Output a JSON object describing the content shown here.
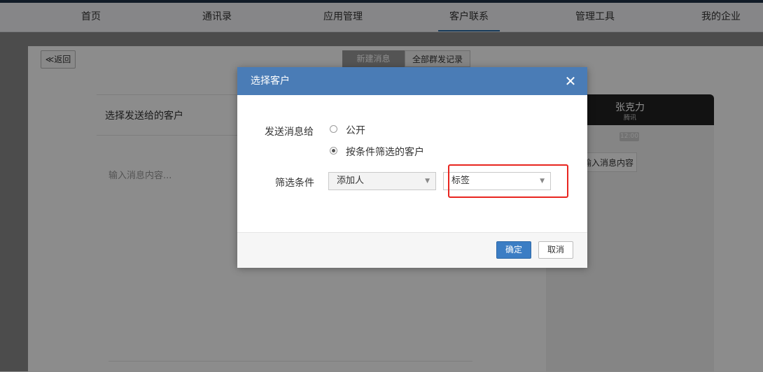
{
  "nav": {
    "items": [
      {
        "label": "首页"
      },
      {
        "label": "通讯录"
      },
      {
        "label": "应用管理"
      },
      {
        "label": "客户联系",
        "active": true
      },
      {
        "label": "管理工具"
      },
      {
        "label": "我的企业"
      }
    ]
  },
  "page": {
    "back_label": "≪返回",
    "tabs": [
      {
        "label": "新建消息",
        "selected": true
      },
      {
        "label": "全部群发记录"
      }
    ],
    "select_customers_label": "选择发送给的客户",
    "message_placeholder": "输入消息内容...",
    "preview": {
      "name": "张克力",
      "subtitle": "腾讯",
      "time": "12:00",
      "bubble": "输入消息内容"
    }
  },
  "modal": {
    "title": "选择客户",
    "close_icon": "close-icon",
    "send_to_label": "发送消息给",
    "options": [
      {
        "label": "公开",
        "checked": false
      },
      {
        "label": "按条件筛选的客户",
        "checked": true
      }
    ],
    "filter_label": "筛选条件",
    "filter_adder": "添加人",
    "filter_tag": "标签",
    "confirm_label": "确定",
    "cancel_label": "取消"
  },
  "colors": {
    "header_blue": "#4a7cb6",
    "primary_button": "#3b7dc4",
    "highlight_red": "#e8251f",
    "active_nav_underline": "#2d6ca5"
  }
}
